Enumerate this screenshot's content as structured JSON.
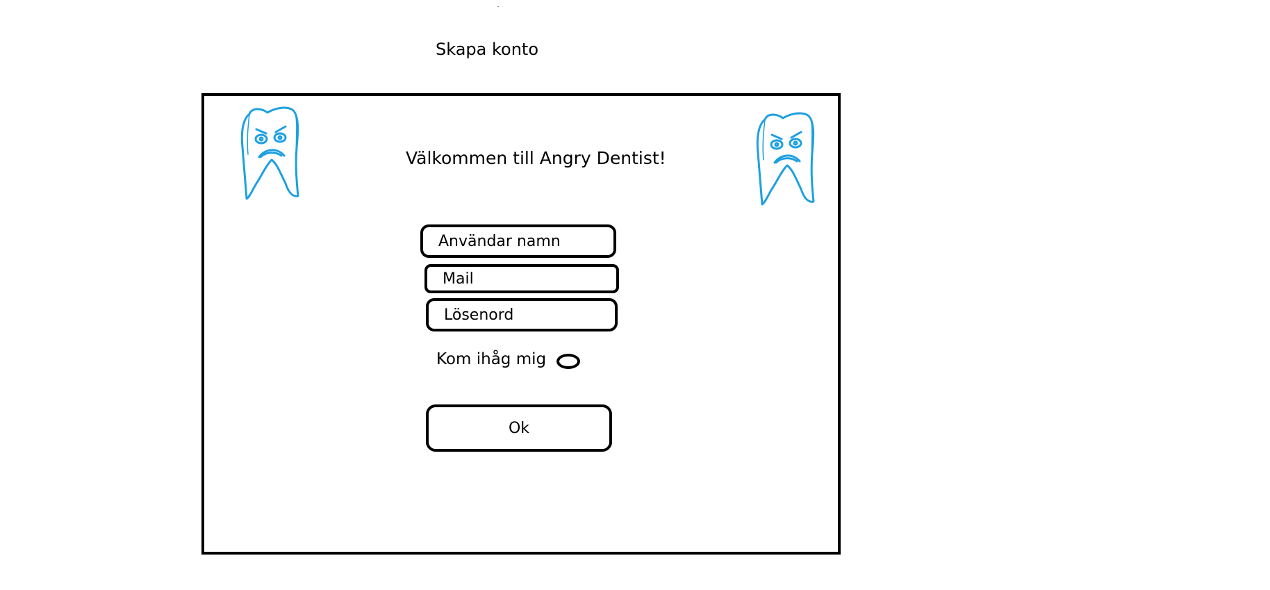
{
  "header": {
    "title": "Skapa konto"
  },
  "form": {
    "welcome": "Välkommen till Angry Dentist!",
    "username_placeholder": "Användar namn",
    "mail_placeholder": "Mail",
    "password_placeholder": "Lösenord",
    "remember_label": "Kom ihåg mig",
    "remember_checked": false,
    "ok_label": "Ok"
  },
  "mascots": {
    "icon": "angry-tooth-icon",
    "color": "#1ea0e0"
  },
  "colors": {
    "background": "#ffffff",
    "border": "#000000",
    "text": "#000000"
  }
}
